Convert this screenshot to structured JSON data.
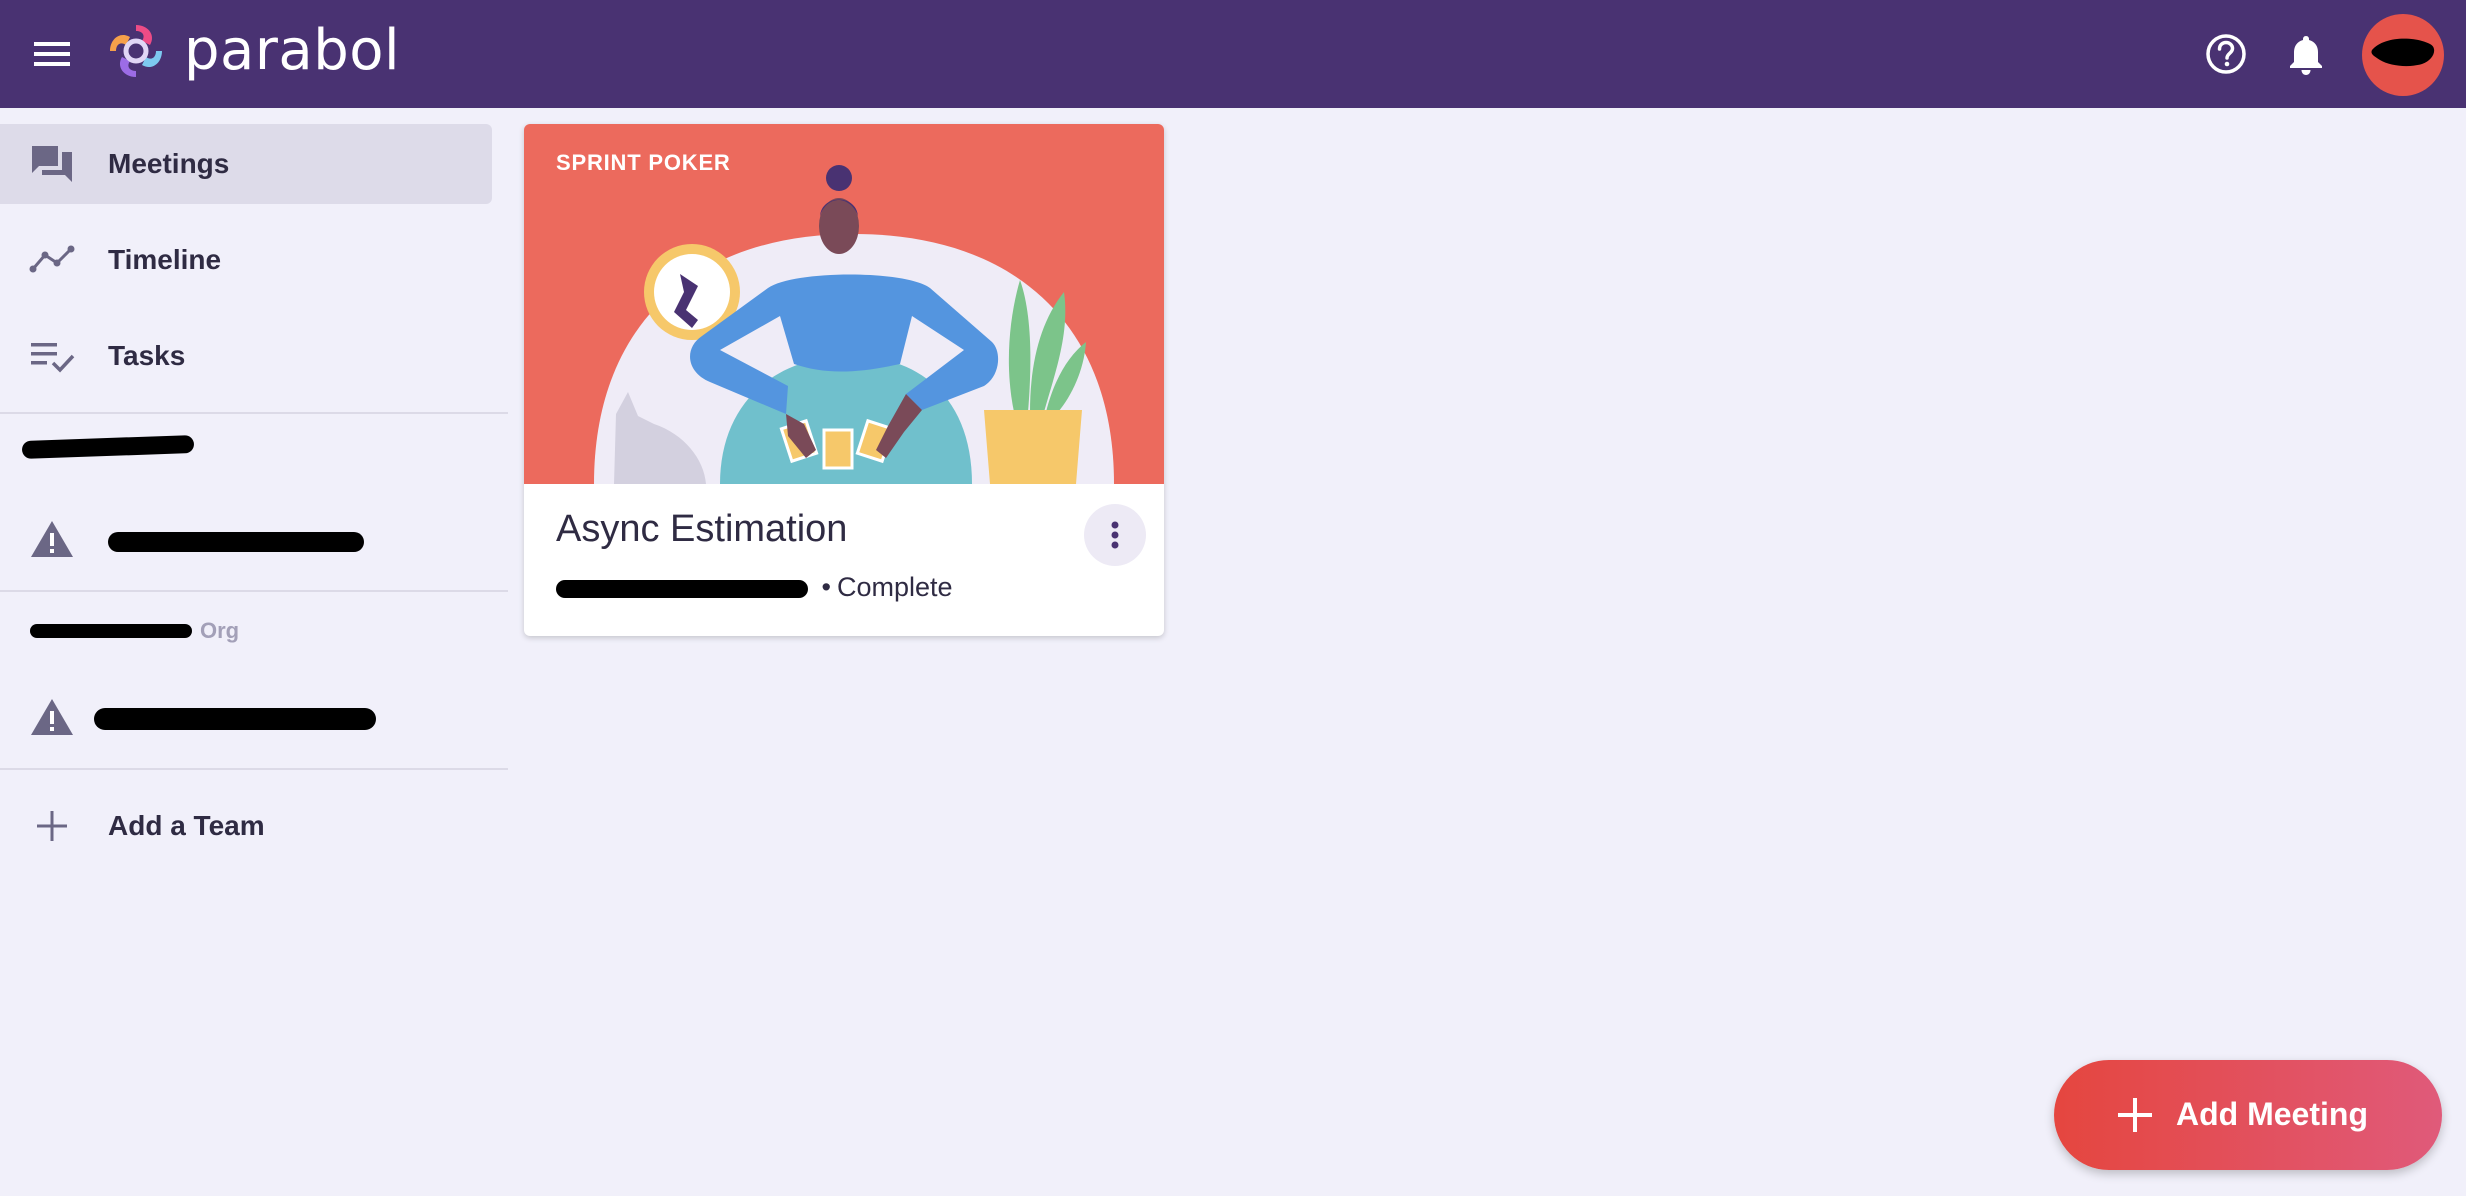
{
  "app": {
    "brand_name": "parabol",
    "colors": {
      "topbar": "#493272",
      "accent": "#e5463f",
      "background": "#f1f0fa"
    }
  },
  "header": {
    "menu_icon": "hamburger-menu-icon",
    "help_icon": "help-circle-icon",
    "notifications_icon": "bell-icon"
  },
  "sidebar": {
    "items": [
      {
        "label": "Meetings",
        "icon": "forum-icon",
        "active": true
      },
      {
        "label": "Timeline",
        "icon": "timeline-icon",
        "active": false
      },
      {
        "label": "Tasks",
        "icon": "playlist-check-icon",
        "active": false
      }
    ],
    "org_suffix_2": "Org",
    "team_icon": "warning-icon",
    "add_team_label": "Add a Team"
  },
  "meeting_card": {
    "type_label": "SPRINT POKER",
    "title": "Async Estimation",
    "status": "Complete",
    "menu_icon": "more-vert-icon"
  },
  "fab": {
    "label": "Add Meeting",
    "icon": "plus-icon"
  }
}
